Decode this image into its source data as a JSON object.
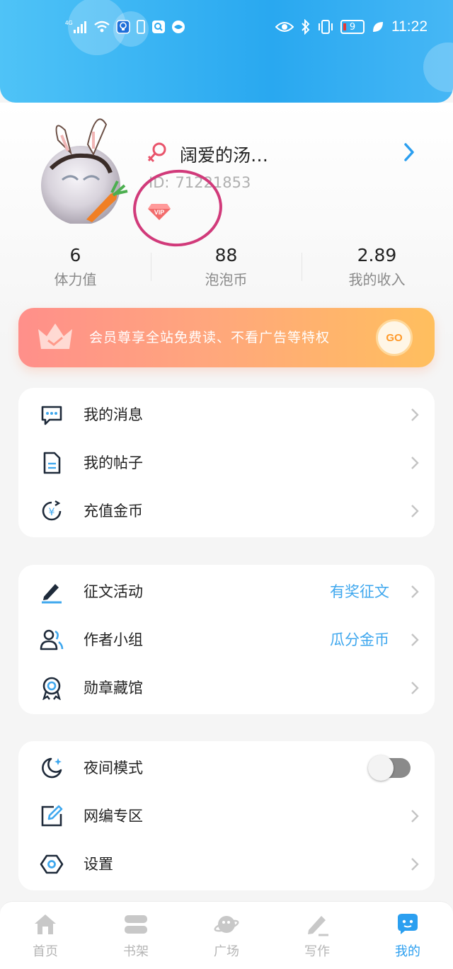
{
  "status_bar": {
    "network": "4G",
    "battery": "9",
    "time": "11:22"
  },
  "profile": {
    "nickname": "阔爱的汤…",
    "id_label": "ID:",
    "id_value": "71221853",
    "vip_badge": "VIP"
  },
  "stats": [
    {
      "value": "6",
      "label": "体力值"
    },
    {
      "value": "88",
      "label": "泡泡币"
    },
    {
      "value": "2.89",
      "label": "我的收入"
    }
  ],
  "vip_banner": {
    "text": "会员尊享全站免费读、不看广告等特权",
    "go_label": "GO"
  },
  "menu_group_1": [
    {
      "label": "我的消息",
      "icon": "message-icon"
    },
    {
      "label": "我的帖子",
      "icon": "document-icon"
    },
    {
      "label": "充值金币",
      "icon": "recharge-icon"
    }
  ],
  "menu_group_2": [
    {
      "label": "征文活动",
      "extra": "有奖征文",
      "icon": "pen-icon"
    },
    {
      "label": "作者小组",
      "extra": "瓜分金币",
      "icon": "group-icon"
    },
    {
      "label": "勋章藏馆",
      "extra": "",
      "icon": "medal-icon"
    }
  ],
  "menu_group_3": [
    {
      "label": "夜间模式",
      "icon": "moon-icon",
      "toggle": false
    },
    {
      "label": "网编专区",
      "icon": "edit-box-icon"
    },
    {
      "label": "设置",
      "icon": "settings-icon"
    }
  ],
  "bottom_nav": [
    {
      "label": "首页",
      "icon": "home-icon",
      "active": false
    },
    {
      "label": "书架",
      "icon": "bookshelf-icon",
      "active": false
    },
    {
      "label": "广场",
      "icon": "planet-icon",
      "active": false
    },
    {
      "label": "写作",
      "icon": "write-icon",
      "active": false
    },
    {
      "label": "我的",
      "icon": "chat-bubble-icon",
      "active": true
    }
  ],
  "colors": {
    "header": "#29a8f0",
    "accent_blue": "#3ea7ee",
    "vip_gradient_start": "#ff8f8a",
    "vip_gradient_end": "#ffbf5e",
    "annotation_circle": "#d13a7a"
  }
}
